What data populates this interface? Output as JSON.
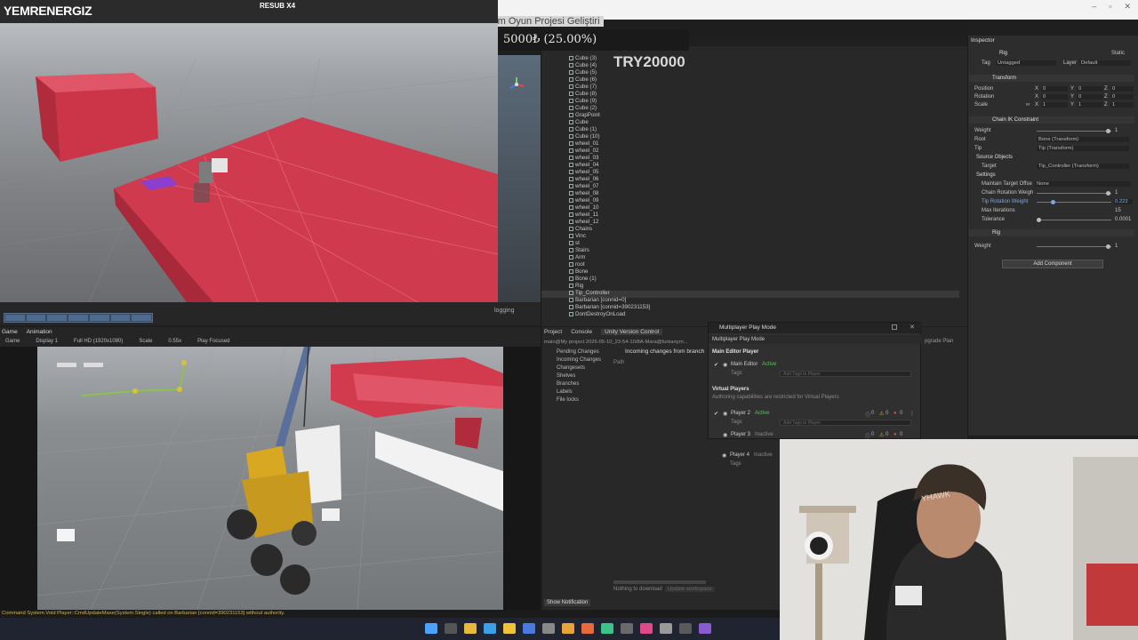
{
  "overlay": {
    "streamer_name": "YEMRENERGIZ",
    "resub_label": "RESUB X4",
    "donation_progress": "5000₺ (25.00%)",
    "donation_goal": "TRY20000",
    "project_title": "Steam Oyun Projesi Geliştiri"
  },
  "scene": {
    "logging_label": "logging"
  },
  "hierarchy": {
    "items": [
      "Cube (3)",
      "Cube (4)",
      "Cube (5)",
      "Cube (6)",
      "Cube (7)",
      "Cube (8)",
      "Cube (9)",
      "Cube (2)",
      "GrapPoint",
      "Cube",
      "Cube (1)",
      "Cube (10)",
      "wheel_01",
      "wheel_02",
      "wheel_03",
      "wheel_04",
      "wheel_05",
      "wheel_06",
      "wheel_07",
      "wheel_08",
      "wheel_09",
      "wheel_10",
      "wheel_11",
      "wheel_12",
      "Chains",
      "Vinc",
      "st",
      "Stairs",
      "Arm",
      "root",
      "Bone",
      "Bone (1)",
      "Rig",
      "Tip_Controller",
      "Barbarian [connid=0]",
      "Barbarian [connid=390231153]",
      "DontDestroyOnLoad"
    ]
  },
  "inspector": {
    "tab": "Inspector",
    "object_name": "Rig",
    "static_label": "Static",
    "tag_label": "Tag",
    "tag_value": "Untagged",
    "layer_label": "Layer",
    "layer_value": "Default",
    "transform_title": "Transform",
    "position_label": "Position",
    "rotation_label": "Rotation",
    "scale_label": "Scale",
    "axis_x": "X",
    "axis_y": "Y",
    "axis_z": "Z",
    "zero": "0",
    "one": "1",
    "chain_ik_title": "Chain IK Constraint",
    "weight_label": "Weight",
    "root_label": "Root",
    "root_value": "Bone (Transform)",
    "tip_label": "Tip",
    "tip_value": "Tip (Transform)",
    "source_objects_label": "Source Objects",
    "target_label": "Target",
    "target_value": "Tip_Controller (Transform)",
    "settings_label": "Settings",
    "maintain_offset_label": "Maintain Target Offse",
    "maintain_offset_value": "None",
    "chain_rot_label": "Chain Rotation Weigh",
    "tip_rot_label": "Tip Rotation Weight",
    "tip_rot_value": "0.223",
    "max_iter_label": "Max Iterations",
    "max_iter_value": "15",
    "tolerance_label": "Tolerance",
    "tolerance_value": "0.0001",
    "rig_section": "Rig",
    "add_component": "Add Component"
  },
  "game": {
    "tab_game": "Game",
    "tab_animation": "Animation",
    "game_dropdown": "Game",
    "display": "Display 1",
    "resolution": "Full HD (1920x1080)",
    "scale_label": "Scale",
    "scale_value": "0.55x",
    "play_focused": "Play Focused"
  },
  "version_control": {
    "tab_project": "Project",
    "tab_console": "Console",
    "tab_uvc": "Unity Version Control",
    "path": "main@My project 2026-05-10_23-54-10/8A-Mara@furkanyrn...",
    "sidebar": [
      "Pending Changes",
      "Incoming Changes",
      "Changesets",
      "Shelves",
      "Branches",
      "Labels",
      "File locks"
    ],
    "incoming_title": "Incoming changes from branch",
    "path_col": "Path",
    "nothing_to_download": "Nothing to download",
    "update_workspace": "Update workspace",
    "show_notification": "Show Notification",
    "upgrade_plan": "pgrade Plan"
  },
  "multiplayer": {
    "window_title": "Multiplayer Play Mode",
    "tab": "Multiplayer Play Mode",
    "main_editor_header": "Main Editor Player",
    "main_editor_name": "Main Editor",
    "active": "Active",
    "tags_label": "Tags",
    "add_tags": "Add Tags to Player",
    "virtual_players_header": "Virtual Players",
    "authoring_note": "Authoring capabilities are restricted for Virtual Players",
    "player2": "Player 2",
    "player3": "Player 3",
    "player4": "Player 4",
    "inactive": "Inactive",
    "badge_zero": "0"
  },
  "status": {
    "message": "Command System.Void Player::CmdUpdateMaxe(System.Single) called on Barbarian [connid=390231153] without authority."
  },
  "colors": {
    "red_block": "#d23a4e",
    "accent_blue": "#3f6fae",
    "status_warning": "#d0b25a",
    "active_green": "#5ec25e"
  }
}
